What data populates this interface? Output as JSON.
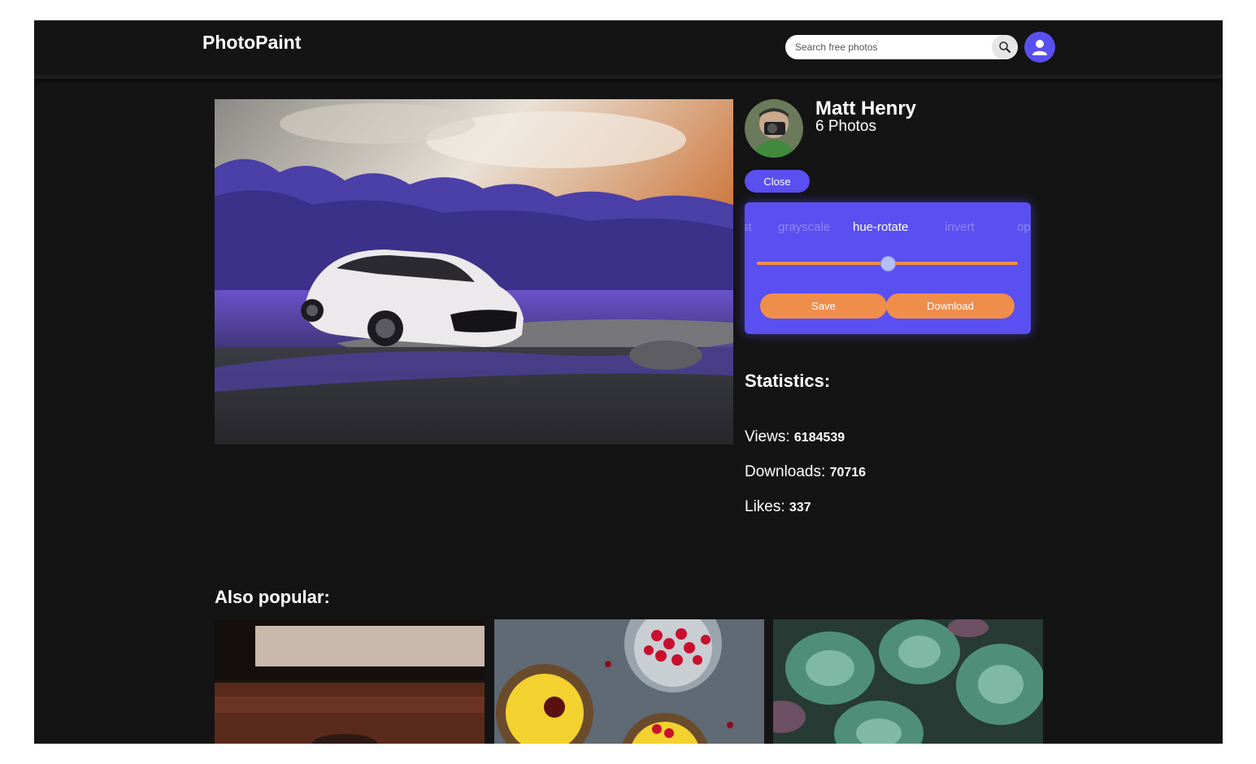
{
  "header": {
    "logo": "PhotoPaint",
    "search_placeholder": "Search free photos",
    "search_icon": "search-icon",
    "profile_icon": "user-icon"
  },
  "photo": {
    "alt": "White car parked on purple grass in front of a purple forest"
  },
  "author": {
    "name": "Matt Henry",
    "photo_count": "6 Photos"
  },
  "editor": {
    "close_label": "Close",
    "filters": [
      "st",
      "grayscale",
      "hue-rotate",
      "invert",
      "op"
    ],
    "active_filter": "hue-rotate",
    "slider_value": 0.5,
    "save_label": "Save",
    "download_label": "Download"
  },
  "statistics": {
    "title": "Statistics:",
    "views_label": "Views:",
    "views": "6184539",
    "downloads_label": "Downloads:",
    "downloads": "70716",
    "likes_label": "Likes:",
    "likes": "337"
  },
  "popular": {
    "title": "Also popular:"
  },
  "colors": {
    "background": "#141414",
    "accent": "#5a4ff0",
    "button": "#ef8d4b"
  }
}
